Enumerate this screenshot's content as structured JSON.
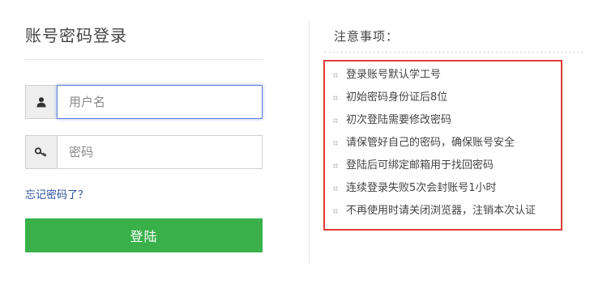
{
  "login": {
    "title": "账号密码登录",
    "username_placeholder": "用户名",
    "password_placeholder": "密码",
    "forgot_link": "忘记密码了？",
    "submit_label": "登陆"
  },
  "notes": {
    "title": "注意事项：",
    "items": [
      "登录账号默认学工号",
      "初始密码身份证后8位",
      "初次登陆需要修改密码",
      "请保管好自己的密码，确保账号安全",
      "登陆后可绑定邮箱用于找回密码",
      "连续登录失败5次会封账号1小时",
      "不再使用时请关闭浏览器，注销本次认证"
    ]
  },
  "colors": {
    "primary_green": "#39b04a",
    "link_blue": "#2a4f9c",
    "highlight_red": "#e23b3b",
    "focus_blue": "#5b7fd6"
  },
  "icons": {
    "username": "user-icon",
    "password": "key-icon"
  }
}
